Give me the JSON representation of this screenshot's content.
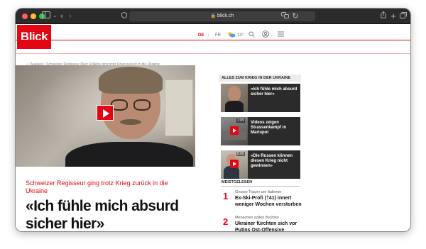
{
  "browser": {
    "url": "blick.ch",
    "lock_icon": "lock-icon",
    "colors": {
      "chrome": "#2b2b2d"
    }
  },
  "site": {
    "logo": "Blick",
    "brand_color": "#e30613",
    "languages": [
      {
        "label": "DE",
        "active": true
      },
      {
        "label": "FR",
        "active": false
      }
    ],
    "weather_temp": "13°",
    "section": "AUSLAND"
  },
  "breadcrumb": {
    "home_icon": "home-icon",
    "items": [
      "Ausland",
      "Schweizer Regisseur Marc Wilkins ging trotz Krieg zurück in die Ukraine"
    ]
  },
  "article": {
    "kicker": "Schweizer Regisseur ging trotz Krieg zurück in die Ukraine",
    "headline": "«Ich fühle mich absurd sicher hier»"
  },
  "sidebar": {
    "title": "ALLES ZUM KRIEG IN DER UKRAINE",
    "videos": [
      {
        "caption": "«Ich fühle mich absurd sicher hier»",
        "duration": ""
      },
      {
        "caption": "Videos zeigen Strassenkampf in Mariupol",
        "duration": "1:09"
      },
      {
        "caption": "«Die Russen können diesen Krieg nicht gewinnen»",
        "duration": "8:00"
      }
    ],
    "most_read_title": "MEISTGELESEN",
    "most_read": [
      {
        "number": "1",
        "kicker": "Grosse Trauer um Italiener",
        "title": "Ex-Ski-Profi (†41) innert weniger Wochen verstorben"
      },
      {
        "number": "2",
        "kicker": "Menschen sollen flüchten",
        "title": "Ukrainer fürchten sich vor Putins Ost-Offensive"
      }
    ]
  }
}
